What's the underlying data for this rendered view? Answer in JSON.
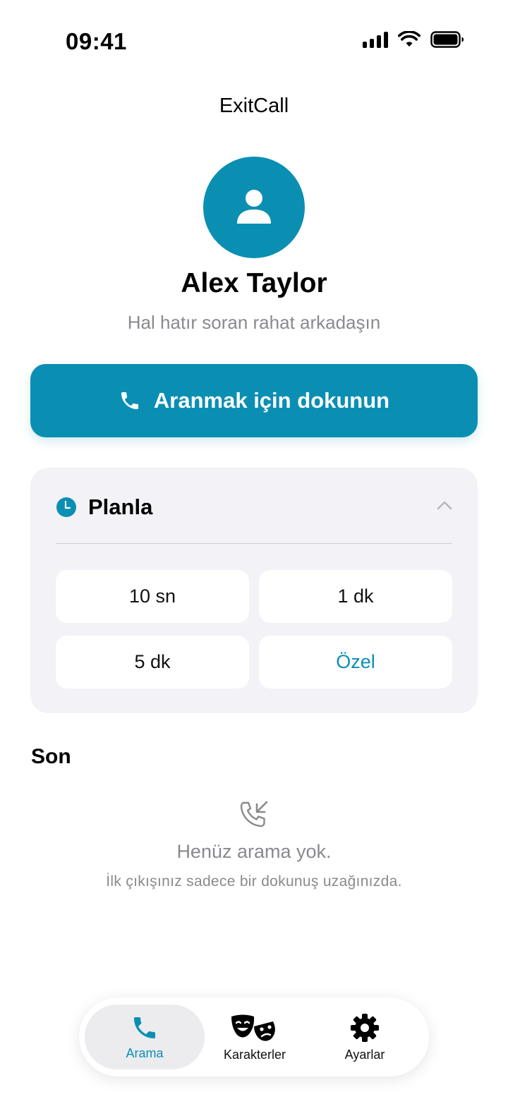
{
  "status_bar": {
    "time": "09:41"
  },
  "header": {
    "app_title": "ExitCall"
  },
  "profile": {
    "name": "Alex Taylor",
    "description": "Hal hatır soran rahat arkadaşın"
  },
  "call_button": {
    "label": "Aranmak için dokunun"
  },
  "schedule": {
    "title": "Planla",
    "options": [
      "10 sn",
      "1 dk",
      "5 dk",
      "Özel"
    ]
  },
  "recent": {
    "title": "Son",
    "empty_title": "Henüz arama yok.",
    "empty_subtitle": "İlk çıkışınız sadece bir dokunuş uzağınızda."
  },
  "tabbar": {
    "tabs": [
      {
        "label": "Arama",
        "icon": "phone-icon",
        "active": true
      },
      {
        "label": "Karakterler",
        "icon": "theater-masks-icon",
        "active": false
      },
      {
        "label": "Ayarlar",
        "icon": "gear-icon",
        "active": false
      }
    ]
  },
  "colors": {
    "accent": "#0a8fb3",
    "card_bg": "#f2f2f7",
    "muted_text": "#8a8a8e"
  }
}
